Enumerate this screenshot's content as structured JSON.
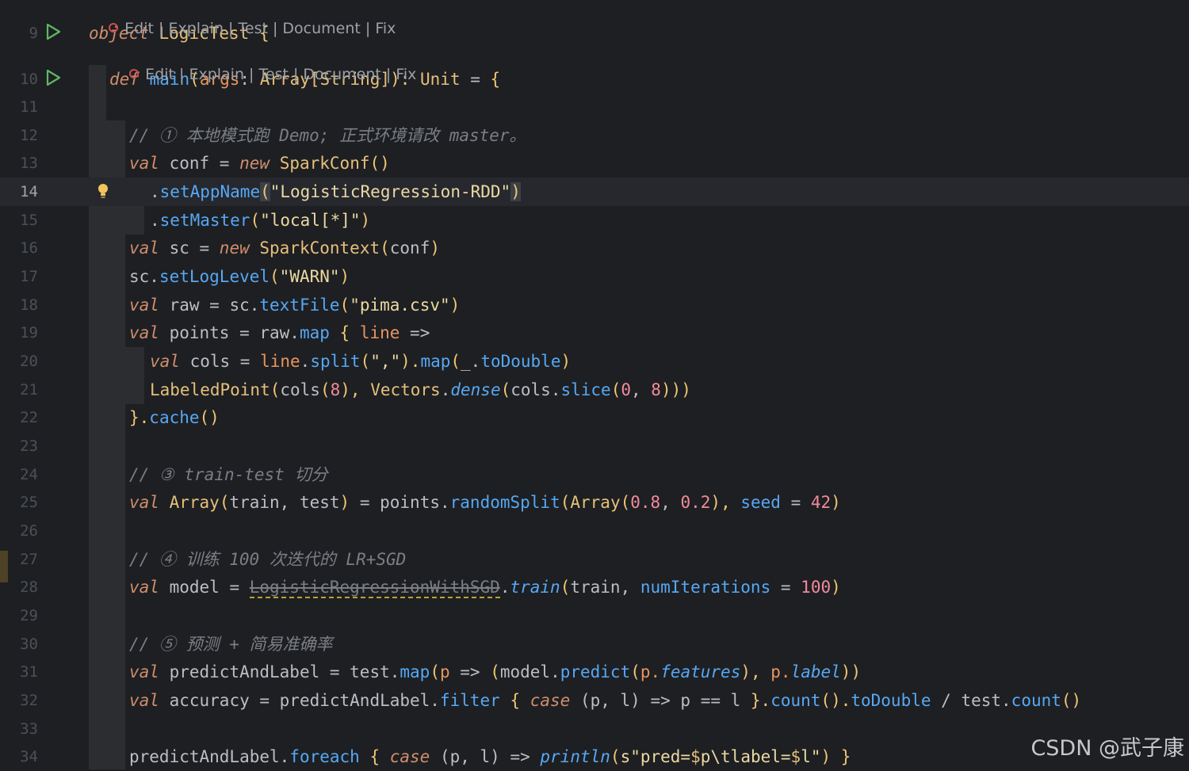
{
  "codelens": {
    "actions": [
      "Edit",
      "Explain",
      "Test",
      "Document",
      "Fix"
    ],
    "separator": " | "
  },
  "lines": [
    {
      "n": "9",
      "tokens": [
        {
          "t": "object",
          "c": "kw"
        },
        {
          "t": " ",
          "c": "op"
        },
        {
          "t": "LogicTest",
          "c": "ty"
        },
        {
          "t": " {",
          "c": "br"
        }
      ]
    },
    {
      "n": "10",
      "tokens": [
        {
          "t": "def",
          "c": "kw"
        },
        {
          "t": " ",
          "c": "op"
        },
        {
          "t": "main",
          "c": "fn"
        },
        {
          "t": "(",
          "c": "br"
        },
        {
          "t": "args",
          "c": "pr"
        },
        {
          "t": ": ",
          "c": "op"
        },
        {
          "t": "Array[String]",
          "c": "ty"
        },
        {
          "t": "): ",
          "c": "br"
        },
        {
          "t": "Unit",
          "c": "ty"
        },
        {
          "t": " = ",
          "c": "op"
        },
        {
          "t": "{",
          "c": "br"
        }
      ]
    },
    {
      "n": "11",
      "tokens": []
    },
    {
      "n": "12",
      "tokens": [
        {
          "t": "// ① 本地模式跑 Demo; 正式环境请改 master。",
          "c": "cm"
        }
      ]
    },
    {
      "n": "13",
      "tokens": [
        {
          "t": "val",
          "c": "kw"
        },
        {
          "t": " conf = ",
          "c": "op"
        },
        {
          "t": "new",
          "c": "kw"
        },
        {
          "t": " ",
          "c": "op"
        },
        {
          "t": "SparkConf",
          "c": "ty"
        },
        {
          "t": "()",
          "c": "br"
        }
      ]
    },
    {
      "n": "14",
      "tokens": [
        {
          "t": ".",
          "c": "op"
        },
        {
          "t": "setAppName",
          "c": "fn"
        },
        {
          "t": "(",
          "c": "br hl"
        },
        {
          "t": "\"LogisticRegression-RDD\"",
          "c": "st"
        },
        {
          "t": ")",
          "c": "br hl"
        }
      ]
    },
    {
      "n": "15",
      "tokens": [
        {
          "t": ".",
          "c": "op"
        },
        {
          "t": "setMaster",
          "c": "fn"
        },
        {
          "t": "(",
          "c": "br"
        },
        {
          "t": "\"local[*]\"",
          "c": "st"
        },
        {
          "t": ")",
          "c": "br"
        }
      ]
    },
    {
      "n": "16",
      "tokens": [
        {
          "t": "val",
          "c": "kw"
        },
        {
          "t": " sc = ",
          "c": "op"
        },
        {
          "t": "new",
          "c": "kw"
        },
        {
          "t": " ",
          "c": "op"
        },
        {
          "t": "SparkContext",
          "c": "ty"
        },
        {
          "t": "(",
          "c": "br"
        },
        {
          "t": "conf",
          "c": "op"
        },
        {
          "t": ")",
          "c": "br"
        }
      ]
    },
    {
      "n": "17",
      "tokens": [
        {
          "t": "sc.",
          "c": "op"
        },
        {
          "t": "setLogLevel",
          "c": "fn"
        },
        {
          "t": "(",
          "c": "br"
        },
        {
          "t": "\"WARN\"",
          "c": "st"
        },
        {
          "t": ")",
          "c": "br"
        }
      ]
    },
    {
      "n": "18",
      "tokens": [
        {
          "t": "val",
          "c": "kw"
        },
        {
          "t": " raw = sc.",
          "c": "op"
        },
        {
          "t": "textFile",
          "c": "fn"
        },
        {
          "t": "(",
          "c": "br"
        },
        {
          "t": "\"pima.csv\"",
          "c": "st"
        },
        {
          "t": ")",
          "c": "br"
        }
      ]
    },
    {
      "n": "19",
      "tokens": [
        {
          "t": "val",
          "c": "kw"
        },
        {
          "t": " points = raw.",
          "c": "op"
        },
        {
          "t": "map",
          "c": "fn"
        },
        {
          "t": " { ",
          "c": "br"
        },
        {
          "t": "line",
          "c": "pr"
        },
        {
          "t": " =>",
          "c": "op"
        }
      ]
    },
    {
      "n": "20",
      "tokens": [
        {
          "t": "val",
          "c": "kw"
        },
        {
          "t": " cols = ",
          "c": "op"
        },
        {
          "t": "line",
          "c": "pr"
        },
        {
          "t": ".",
          "c": "op"
        },
        {
          "t": "split",
          "c": "fn"
        },
        {
          "t": "(",
          "c": "br"
        },
        {
          "t": "\",\"",
          "c": "st"
        },
        {
          "t": ").",
          "c": "br"
        },
        {
          "t": "map",
          "c": "fn"
        },
        {
          "t": "(",
          "c": "br"
        },
        {
          "t": "_.",
          "c": "op"
        },
        {
          "t": "toDouble",
          "c": "fn"
        },
        {
          "t": ")",
          "c": "br"
        }
      ]
    },
    {
      "n": "21",
      "tokens": [
        {
          "t": "LabeledPoint",
          "c": "ty"
        },
        {
          "t": "(",
          "c": "br"
        },
        {
          "t": "cols",
          "c": "op"
        },
        {
          "t": "(",
          "c": "br"
        },
        {
          "t": "8",
          "c": "nm"
        },
        {
          "t": "), ",
          "c": "br"
        },
        {
          "t": "Vectors",
          "c": "ty"
        },
        {
          "t": ".",
          "c": "op"
        },
        {
          "t": "dense",
          "c": "it"
        },
        {
          "t": "(",
          "c": "br"
        },
        {
          "t": "cols.",
          "c": "op"
        },
        {
          "t": "slice",
          "c": "fn"
        },
        {
          "t": "(",
          "c": "br"
        },
        {
          "t": "0",
          "c": "nm"
        },
        {
          "t": ", ",
          "c": "op"
        },
        {
          "t": "8",
          "c": "nm"
        },
        {
          "t": ")))",
          "c": "br"
        }
      ]
    },
    {
      "n": "22",
      "tokens": [
        {
          "t": "}.",
          "c": "br"
        },
        {
          "t": "cache",
          "c": "fn"
        },
        {
          "t": "()",
          "c": "br"
        }
      ]
    },
    {
      "n": "23",
      "tokens": []
    },
    {
      "n": "24",
      "tokens": [
        {
          "t": "// ③ train-test 切分",
          "c": "cm"
        }
      ]
    },
    {
      "n": "25",
      "tokens": [
        {
          "t": "val",
          "c": "kw"
        },
        {
          "t": " ",
          "c": "op"
        },
        {
          "t": "Array",
          "c": "ty"
        },
        {
          "t": "(",
          "c": "br"
        },
        {
          "t": "train, test",
          "c": "op"
        },
        {
          "t": ")",
          "c": "br"
        },
        {
          "t": " = points.",
          "c": "op"
        },
        {
          "t": "randomSplit",
          "c": "fn"
        },
        {
          "t": "(",
          "c": "br"
        },
        {
          "t": "Array",
          "c": "ty"
        },
        {
          "t": "(",
          "c": "br"
        },
        {
          "t": "0.8",
          "c": "nm"
        },
        {
          "t": ", ",
          "c": "op"
        },
        {
          "t": "0.2",
          "c": "nm"
        },
        {
          "t": "), ",
          "c": "br"
        },
        {
          "t": "seed",
          "c": "fn"
        },
        {
          "t": " = ",
          "c": "op"
        },
        {
          "t": "42",
          "c": "nm"
        },
        {
          "t": ")",
          "c": "br"
        }
      ]
    },
    {
      "n": "26",
      "tokens": []
    },
    {
      "n": "27",
      "tokens": [
        {
          "t": "// ④ 训练 100 次迭代的 LR+SGD",
          "c": "cm"
        }
      ]
    },
    {
      "n": "28",
      "tokens": [
        {
          "t": "val",
          "c": "kw"
        },
        {
          "t": " model = ",
          "c": "op"
        },
        {
          "t": "LogisticRegressionWithSGD",
          "c": "strike"
        },
        {
          "t": ".",
          "c": "op"
        },
        {
          "t": "train",
          "c": "it"
        },
        {
          "t": "(",
          "c": "br"
        },
        {
          "t": "train, ",
          "c": "op"
        },
        {
          "t": "numIterations",
          "c": "fn"
        },
        {
          "t": " = ",
          "c": "op"
        },
        {
          "t": "100",
          "c": "nm"
        },
        {
          "t": ")",
          "c": "br"
        }
      ]
    },
    {
      "n": "29",
      "tokens": []
    },
    {
      "n": "30",
      "tokens": [
        {
          "t": "// ⑤ 预测 + 简易准确率",
          "c": "cm"
        }
      ]
    },
    {
      "n": "31",
      "tokens": [
        {
          "t": "val",
          "c": "kw"
        },
        {
          "t": " predictAndLabel = test.",
          "c": "op"
        },
        {
          "t": "map",
          "c": "fn"
        },
        {
          "t": "(",
          "c": "br"
        },
        {
          "t": "p",
          "c": "pr"
        },
        {
          "t": " => ",
          "c": "op"
        },
        {
          "t": "(",
          "c": "br"
        },
        {
          "t": "model.",
          "c": "op"
        },
        {
          "t": "predict",
          "c": "fn"
        },
        {
          "t": "(",
          "c": "br"
        },
        {
          "t": "p.",
          "c": "pr"
        },
        {
          "t": "features",
          "c": "it"
        },
        {
          "t": "), ",
          "c": "br"
        },
        {
          "t": "p.",
          "c": "pr"
        },
        {
          "t": "label",
          "c": "it"
        },
        {
          "t": "))",
          "c": "br"
        }
      ]
    },
    {
      "n": "32",
      "tokens": [
        {
          "t": "val",
          "c": "kw"
        },
        {
          "t": " accuracy = predictAndLabel.",
          "c": "op"
        },
        {
          "t": "filter",
          "c": "fn"
        },
        {
          "t": " { ",
          "c": "br"
        },
        {
          "t": "case",
          "c": "kw"
        },
        {
          "t": " (p, l) => p == l ",
          "c": "op"
        },
        {
          "t": "}.",
          "c": "br"
        },
        {
          "t": "count",
          "c": "fn"
        },
        {
          "t": "().",
          "c": "br"
        },
        {
          "t": "toDouble",
          "c": "fn"
        },
        {
          "t": " / test.",
          "c": "op"
        },
        {
          "t": "count",
          "c": "fn"
        },
        {
          "t": "()",
          "c": "br"
        }
      ]
    },
    {
      "n": "33",
      "tokens": []
    },
    {
      "n": "34",
      "tokens": [
        {
          "t": "predictAndLabel.",
          "c": "op"
        },
        {
          "t": "foreach",
          "c": "fn"
        },
        {
          "t": " { ",
          "c": "br"
        },
        {
          "t": "case",
          "c": "kw"
        },
        {
          "t": " (p, l) => ",
          "c": "op"
        },
        {
          "t": "println",
          "c": "it"
        },
        {
          "t": "(",
          "c": "br"
        },
        {
          "t": "s\"pred=",
          "c": "st"
        },
        {
          "t": "$",
          "c": "ty"
        },
        {
          "t": "p\\tlabel=",
          "c": "st"
        },
        {
          "t": "$",
          "c": "ty"
        },
        {
          "t": "l\"",
          "c": "st"
        },
        {
          "t": ") }",
          "c": "br"
        }
      ]
    }
  ],
  "current_line": "14",
  "watermark": "CSDN @武子康"
}
